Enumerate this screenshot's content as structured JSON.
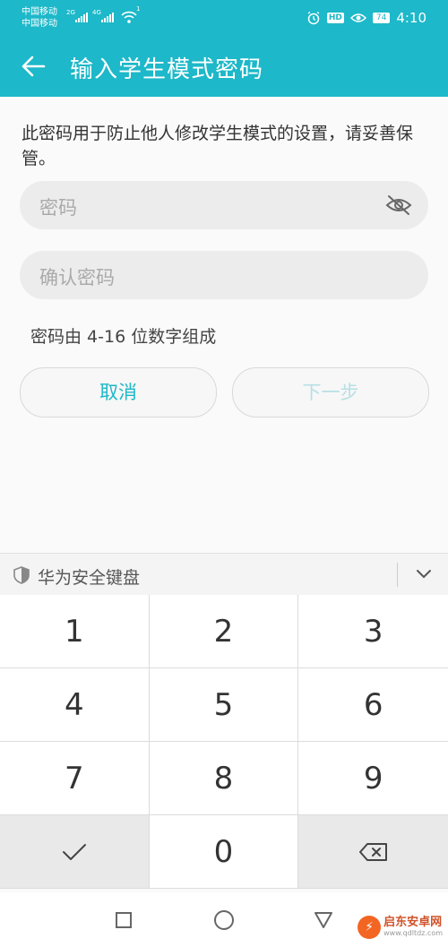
{
  "status_bar": {
    "carrier_1": "中国移动",
    "carrier_2": "中国移动",
    "net_1": "2G",
    "net_2": "4G",
    "wifi_badge": "1",
    "battery": "74",
    "time": "4:10",
    "hd": "HD"
  },
  "app_bar": {
    "title": "输入学生模式密码"
  },
  "description": "此密码用于防止他人修改学生模式的设置，请妥善保管。",
  "password_field": {
    "placeholder": "密码"
  },
  "confirm_field": {
    "placeholder": "确认密码"
  },
  "hint": "密码由 4-16 位数字组成",
  "buttons": {
    "cancel": "取消",
    "next": "下一步"
  },
  "keyboard": {
    "title": "华为安全键盘",
    "keys": [
      "1",
      "2",
      "3",
      "4",
      "5",
      "6",
      "7",
      "8",
      "9",
      "0"
    ]
  },
  "watermark": {
    "name": "启东安卓网",
    "url": "www.qdltdz.com"
  },
  "colors": {
    "accent": "#1db8c9",
    "disabled_text": "#b7dfe4"
  }
}
